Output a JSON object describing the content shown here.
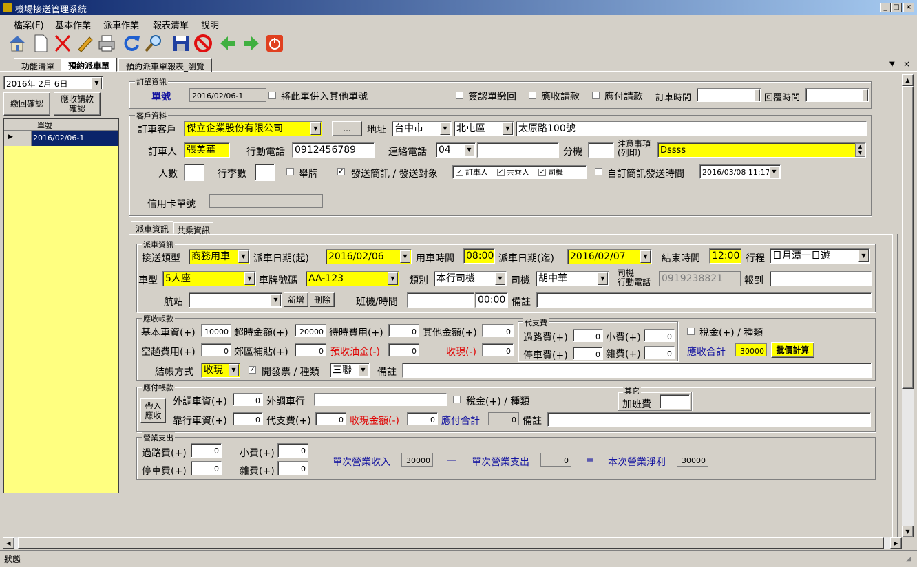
{
  "window": {
    "title": "機場接送管理系統"
  },
  "menu": [
    "檔案(F)",
    "基本作業",
    "派車作業",
    "報表清單",
    "說明"
  ],
  "toolbar": {
    "icons": [
      "home-icon",
      "new-document-icon",
      "delete-x-icon",
      "edit-pencil-icon",
      "print-icon",
      "refresh-icon",
      "search-icon",
      "save-icon",
      "stop-icon",
      "back-arrow-icon",
      "forward-arrow-icon",
      "power-icon"
    ]
  },
  "tabs": {
    "main": [
      "功能清單",
      "預約派車單",
      "預約派車單報表_瀏覽"
    ]
  },
  "left": {
    "date": "2016年  2月  6日",
    "btn_return": "繳回確認",
    "btn_receivable": "應收請款\n確認",
    "col_header": "單號",
    "rows": [
      "2016/02/06-1"
    ]
  },
  "order": {
    "group": "訂單資訊",
    "label_no": "單號",
    "no": "2016/02/06-1",
    "merge": "將此單併入其他單號",
    "sign": "簽認單繳回",
    "receivable": "應收請款",
    "payable": "應付請款",
    "order_time": "訂車時間",
    "reply_time": "回覆時間"
  },
  "customer": {
    "group": "客戶資料",
    "label_customer": "訂車客戶",
    "customer": "傑立企業股份有限公司",
    "browse": "...",
    "label_addr": "地址",
    "city": "台中市",
    "district": "北屯區",
    "address": "太原路100號",
    "label_person": "訂車人",
    "person": "張美華",
    "label_mobile": "行動電話",
    "mobile": "0912456789",
    "label_phone": "連絡電話",
    "phone_area": "04",
    "phone": "",
    "label_ext": "分機",
    "ext": "",
    "label_note": "注意事項\n(列印)",
    "note": "Dssss",
    "label_people": "人數",
    "people": "",
    "label_luggage": "行李數",
    "luggage": "",
    "sign_board": "舉牌",
    "sms": "發送簡訊 / 發送對象",
    "sms_targets": [
      "訂車人",
      "共乘人",
      "司機"
    ],
    "custom_sms": "自訂簡訊發送時間",
    "sms_time": "2016/03/08 11:17",
    "label_card": "信用卡單號",
    "card": ""
  },
  "subtabs": [
    "派車資訊",
    "共乘資訊"
  ],
  "dispatch": {
    "group": "派車資訊",
    "label_type": "接送類型",
    "type": "商務用車",
    "label_start": "派車日期(起)",
    "start": "2016/02/06",
    "label_use_time": "用車時間",
    "use_time": "08:00",
    "label_end": "派車日期(迄)",
    "end": "2016/02/07",
    "label_end_time": "結束時間",
    "end_time": "12:00",
    "label_route": "行程",
    "route": "日月潭一日遊",
    "label_cartype": "車型",
    "cartype": "5人座",
    "label_plate": "車牌號碼",
    "plate": "AA-123",
    "label_category": "類別",
    "category": "本行司機",
    "label_driver": "司機",
    "driver": "胡中華",
    "label_driver_mobile": "司機\n行動電話",
    "driver_mobile": "0919238821",
    "label_report": "報到",
    "report": "",
    "label_station": "航站",
    "station": "",
    "add": "新增",
    "del": "刪除",
    "label_flight": "班機/時間",
    "flight": "",
    "flight_time": "00:00",
    "label_memo": "備註",
    "memo": ""
  },
  "receivable": {
    "group": "應收帳款",
    "base": {
      "label": "基本車資(+)",
      "value": "10000"
    },
    "overtime": {
      "label": "超時金額(+)",
      "value": "20000"
    },
    "waiting": {
      "label": "待時費用(+)",
      "value": "0"
    },
    "other": {
      "label": "其他金額(+)",
      "value": "0"
    },
    "empty": {
      "label": "空趟費用(+)",
      "value": "0"
    },
    "suburb": {
      "label": "郊區補貼(+)",
      "value": "0"
    },
    "fuel": {
      "label": "預收油金(-)",
      "value": "0"
    },
    "cash": {
      "label": "收現(-)",
      "value": "0"
    },
    "proxy_group": "代支費",
    "toll": {
      "label": "過路費(+)",
      "value": "0"
    },
    "tip": {
      "label": "小費(+)",
      "value": "0"
    },
    "parking": {
      "label": "停車費(+)",
      "value": "0"
    },
    "misc": {
      "label": "雜費(+)",
      "value": "0"
    },
    "tax": "稅金(+) / 種類",
    "total_label": "應收合計",
    "total": "30000",
    "calc": "批價計算",
    "label_settle": "結帳方式",
    "settle": "收現",
    "invoice": "開發票 / 種類",
    "invoice_type": "三聯",
    "label_memo": "備註",
    "memo": ""
  },
  "payable": {
    "group": "應付帳款",
    "bring": "帶入\n應收",
    "ext_fee": {
      "label": "外調車資(+)",
      "value": "0"
    },
    "ext_co": {
      "label": "外調車行",
      "value": ""
    },
    "tax": "稅金(+) / 種類",
    "other_group": "其它",
    "overtime": {
      "label": "加班費",
      "value": ""
    },
    "affil": {
      "label": "靠行車資(+)",
      "value": "0"
    },
    "proxy": {
      "label": "代支費(+)",
      "value": "0"
    },
    "cash": {
      "label": "收現金額(-)",
      "value": "0"
    },
    "total_label": "應付合計",
    "total": "0",
    "label_memo": "備註",
    "memo": ""
  },
  "business": {
    "group": "營業支出",
    "toll": {
      "label": "過路費(+)",
      "value": "0"
    },
    "tip": {
      "label": "小費(+)",
      "value": "0"
    },
    "parking": {
      "label": "停車費(+)",
      "value": "0"
    },
    "misc": {
      "label": "雜費(+)",
      "value": "0"
    },
    "income_label": "單次營業收入",
    "income": "30000",
    "minus": "—",
    "expense_label": "單次營業支出",
    "expense": "0",
    "eq": "=",
    "net_label": "本次營業淨利",
    "net": "30000"
  },
  "status": "狀態"
}
